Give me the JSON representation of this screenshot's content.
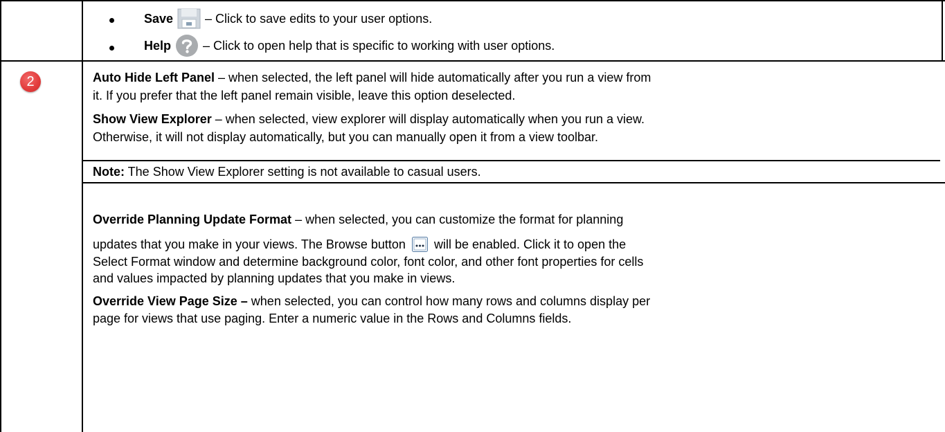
{
  "row1": {
    "items": [
      {
        "label": "Save",
        "desc": " – Click to save edits to your user options.",
        "icon": "save-icon"
      },
      {
        "label": "Help",
        "desc": " – Click to open help that is specific to working with user options.",
        "icon": "help-icon"
      }
    ]
  },
  "row2": {
    "badge": "2",
    "auto_hide": {
      "title": "Auto Hide Left Panel",
      "line1": " – when selected, the left panel will hide automatically after you run a view from",
      "line2": "it. If you prefer that the left panel remain visible, leave this option deselected."
    },
    "show_view": {
      "title": "Show View Explorer",
      "line1": " – when selected, view explorer will display automatically when you run a view.",
      "line2": "Otherwise, it will not display automatically, but you can manually open it from a view toolbar."
    },
    "note": {
      "label": "Note:",
      "text": " The Show View Explorer setting is not available to casual users."
    },
    "override_format": {
      "title": "Override Planning Update Format",
      "line1": " – when selected, you can customize the format for planning",
      "line2a": "updates that you make in your views. The Browse button",
      "line2b": "will be enabled. Click it to open the",
      "line3": "Select Format window and determine background color, font color, and other font properties for cells",
      "line4": "and values impacted by planning updates that you make in views."
    },
    "override_page": {
      "title": "Override View Page Size –",
      "line1": " when selected, you can control how many rows and columns display per",
      "line2": "page for views that use paging. Enter a numeric value in the Rows and Columns fields."
    }
  },
  "colors": {
    "badge": "#e23b3b",
    "border": "#000000"
  }
}
